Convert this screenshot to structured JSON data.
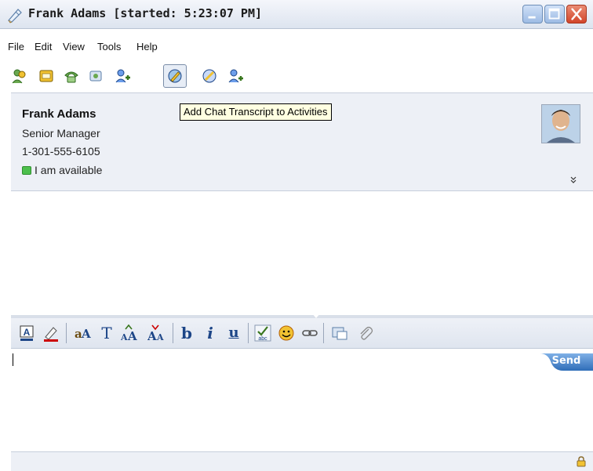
{
  "window": {
    "title": "Frank Adams [started: 5:23:07 PM]",
    "controls": [
      "minimize-icon",
      "maximize-icon",
      "close-icon"
    ]
  },
  "menu": {
    "items": [
      "File",
      "Edit",
      "View",
      "Tools",
      "Help"
    ]
  },
  "toolbar": {
    "icons": [
      "add-contacts-icon",
      "call-icon",
      "phone-icon",
      "send-file-icon",
      "invite-icon",
      "add-transcript-icon",
      "share-icon",
      "add-people-icon"
    ],
    "active_icon": "add-transcript-icon"
  },
  "tooltip": {
    "text": "Add Chat Transcript to Activities"
  },
  "contact": {
    "name": "Frank Adams",
    "title": "Senior Manager",
    "phone": "1-301-555-6105",
    "status": "I am available",
    "status_color": "#4cbf4c"
  },
  "format_toolbar": {
    "icons": [
      "text-color-icon",
      "highlight-icon",
      "font-icon",
      "font-style-icon",
      "grow-font-icon",
      "shrink-font-icon",
      "bold-icon",
      "italic-icon",
      "underline-icon",
      "spellcheck-icon",
      "emoticon-icon",
      "link-icon",
      "screen-capture-icon",
      "attach-icon"
    ],
    "font_label": "T",
    "bold_label": "b",
    "italic_label": "i",
    "underline_label": "u"
  },
  "input": {
    "value": "",
    "send_label": "Send"
  },
  "colors": {
    "accent": "#3b79c9",
    "panel_bg": "#edf0f6",
    "tooltip_bg": "#ffffe1"
  }
}
